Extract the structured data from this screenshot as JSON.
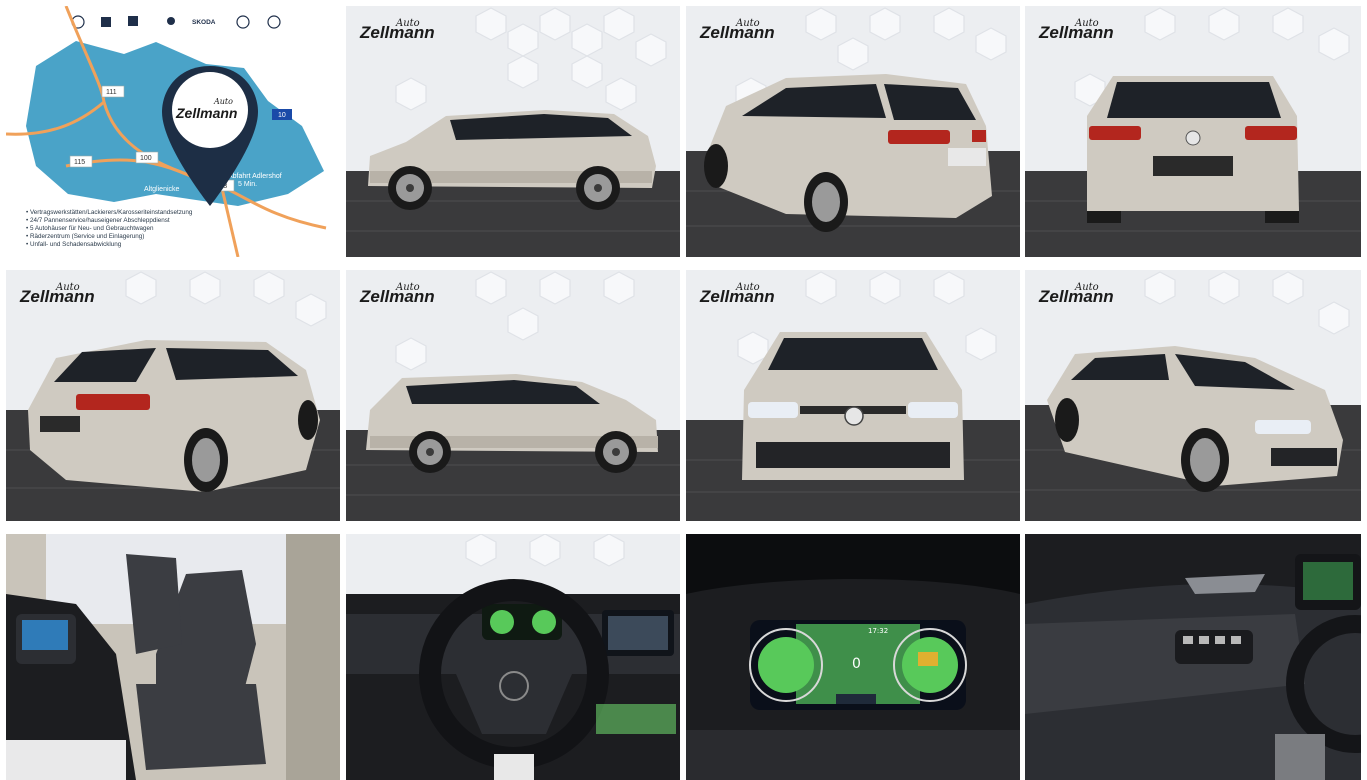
{
  "brand": {
    "logo_script": "Auto",
    "logo_name": "Zellmann"
  },
  "map": {
    "roads": [
      "111",
      "100",
      "115",
      "113",
      "10"
    ],
    "places": [
      "Altglienicke",
      "Abfahrt Adlershof",
      "5 Min."
    ],
    "brand_strip": [
      "SKODA"
    ],
    "bullets": [
      "• Vertragswerkstätten/Lackierers/Karosseriteinstandsetzung",
      "• 24/7 Pannenservice/hauseigener Abschleppdienst",
      "• 5 Autohäuser für Neu- und Gebrauchtwagen",
      "• Räderzentrum (Service und Einlagerung)",
      "• Unfall- und Schadensabwicklung"
    ]
  },
  "gallery": {
    "tiles": [
      {
        "name": "photo-dealer-map"
      },
      {
        "name": "photo-side-left"
      },
      {
        "name": "photo-rear-left-quarter"
      },
      {
        "name": "photo-rear"
      },
      {
        "name": "photo-rear-left-quarter-2"
      },
      {
        "name": "photo-side-left-2"
      },
      {
        "name": "photo-front"
      },
      {
        "name": "photo-front-right-quarter"
      },
      {
        "name": "photo-interior-seats"
      },
      {
        "name": "photo-steering-wheel"
      },
      {
        "name": "photo-instrument-cluster"
      },
      {
        "name": "photo-door-panel"
      }
    ]
  },
  "cluster": {
    "speed": "0",
    "time": "17:32"
  },
  "colors": {
    "map_land": "#4aa3c8",
    "map_roads": "#f0a15a",
    "car_silver": "#cfcac1",
    "studio_floor": "#3a3a3c"
  }
}
